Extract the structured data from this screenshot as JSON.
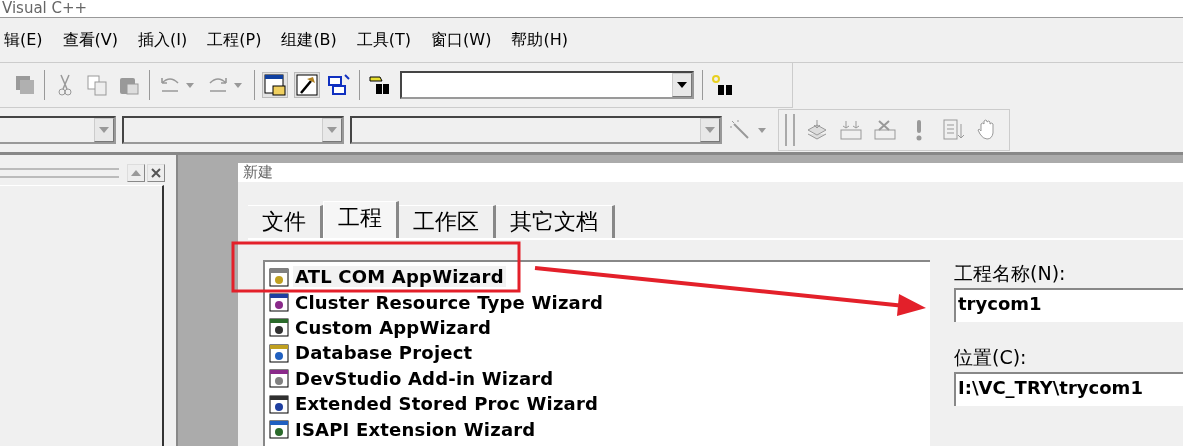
{
  "window": {
    "title": "Visual C++"
  },
  "menu": [
    {
      "label": "辑(E)"
    },
    {
      "label": "查看(V)"
    },
    {
      "label": "插入(I)"
    },
    {
      "label": "工程(P)"
    },
    {
      "label": "组建(B)"
    },
    {
      "label": "工具(T)"
    },
    {
      "label": "窗口(W)"
    },
    {
      "label": "帮助(H)"
    }
  ],
  "dialog": {
    "title": "新建",
    "tabs": [
      {
        "label": "文件",
        "selected": false
      },
      {
        "label": "工程",
        "selected": true
      },
      {
        "label": "工作区",
        "selected": false
      },
      {
        "label": "其它文档",
        "selected": false
      }
    ],
    "project_types": [
      {
        "label": "ATL COM AppWizard",
        "selected": true
      },
      {
        "label": "Cluster Resource Type Wizard",
        "selected": false
      },
      {
        "label": "Custom AppWizard",
        "selected": false
      },
      {
        "label": "Database Project",
        "selected": false
      },
      {
        "label": "DevStudio Add-in Wizard",
        "selected": false
      },
      {
        "label": "Extended Stored Proc Wizard",
        "selected": false
      },
      {
        "label": "ISAPI Extension Wizard",
        "selected": false
      }
    ],
    "fields": [
      {
        "label": "工程名称(N):",
        "value": "trycom1"
      },
      {
        "label": "位置(C):",
        "value": "I:\\VC_TRY\\trycom1"
      }
    ]
  }
}
